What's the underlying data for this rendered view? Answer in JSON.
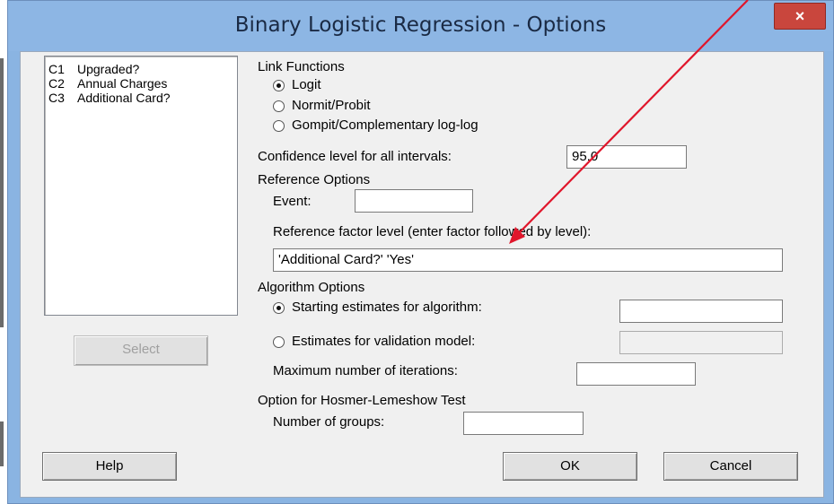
{
  "window": {
    "title": "Binary Logistic Regression - Options",
    "close_label": "×"
  },
  "variables": [
    {
      "code": "C1",
      "name": "Upgraded?"
    },
    {
      "code": "C2",
      "name": "Annual Charges"
    },
    {
      "code": "C3",
      "name": "Additional Card?"
    }
  ],
  "select_button": "Select",
  "link_functions": {
    "heading": "Link Functions",
    "options": [
      "Logit",
      "Normit/Probit",
      "Gompit/Complementary log-log"
    ],
    "selected": "Logit"
  },
  "confidence": {
    "label": "Confidence level for all intervals:",
    "value": "95.0"
  },
  "reference_options": {
    "heading": "Reference Options",
    "event_label": "Event:",
    "event_value": "",
    "factor_label": "Reference factor level (enter factor followed by level):",
    "factor_value": "'Additional Card?' 'Yes'"
  },
  "algorithm_options": {
    "heading": "Algorithm Options",
    "starting_label": "Starting estimates for algorithm:",
    "starting_value": "",
    "validation_label": "Estimates for validation model:",
    "validation_value": "",
    "selected": "Starting estimates for algorithm:",
    "max_iter_label": "Maximum number of iterations:",
    "max_iter_value": ""
  },
  "hosmer": {
    "heading": "Option for Hosmer-Lemeshow Test",
    "groups_label": "Number of groups:",
    "groups_value": ""
  },
  "buttons": {
    "help": "Help",
    "ok": "OK",
    "cancel": "Cancel"
  },
  "colors": {
    "title_bar": "#8db6e4",
    "close_button": "#c9463d",
    "annotation_arrow": "#e0162b"
  }
}
